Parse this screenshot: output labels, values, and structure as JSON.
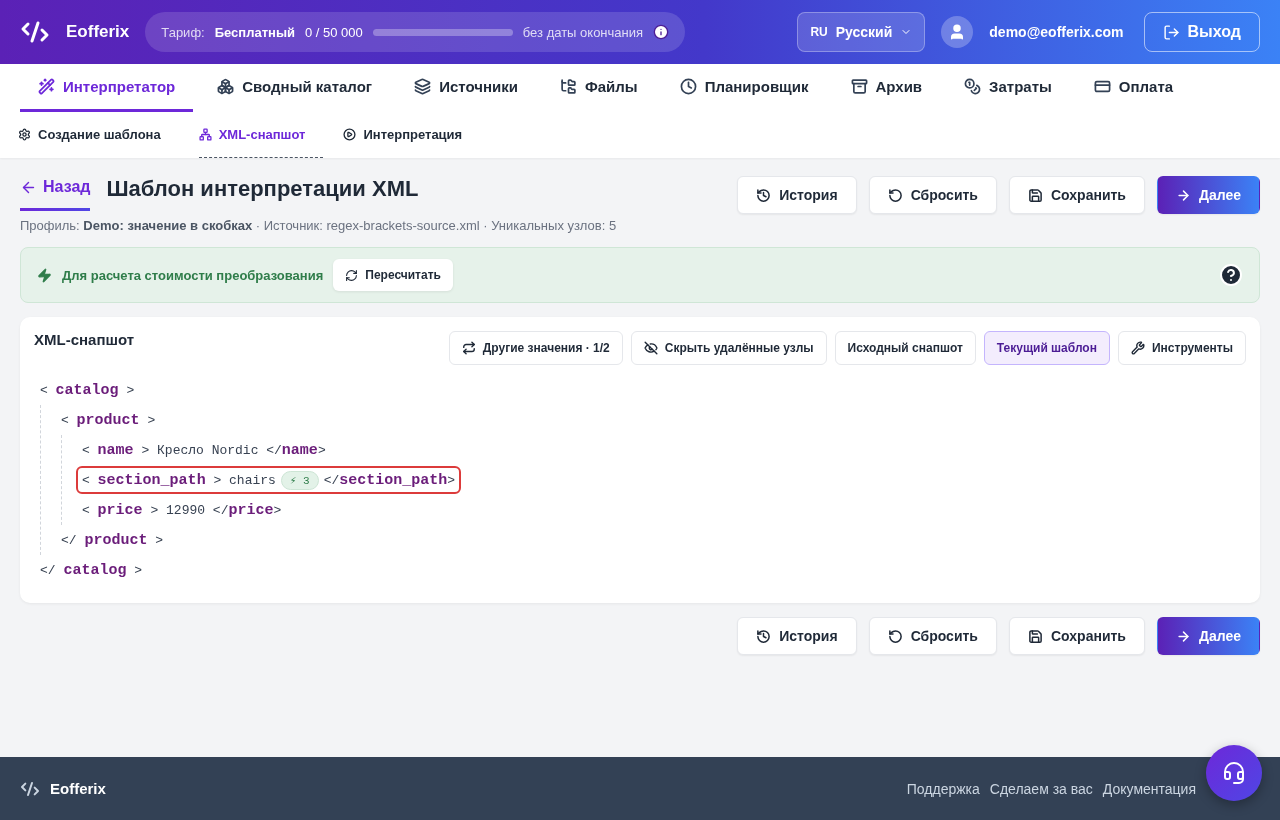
{
  "header": {
    "brand": "Eofferix",
    "plan": {
      "label": "Тариф:",
      "name": "Бесплатный",
      "usage": "0 / 50 000",
      "level": 0,
      "expiry": "без даты окончания"
    },
    "language": {
      "code": "RU",
      "name": "Русский"
    },
    "user": "demo@eofferix.com",
    "logout": "Выход"
  },
  "nav": [
    {
      "label": "Интерпретатор",
      "selected": true
    },
    {
      "label": "Сводный каталог",
      "selected": false
    },
    {
      "label": "Источники",
      "selected": false
    },
    {
      "label": "Файлы",
      "selected": false
    },
    {
      "label": "Планировщик",
      "selected": false
    },
    {
      "label": "Архив",
      "selected": false
    },
    {
      "label": "Затраты",
      "selected": false
    },
    {
      "label": "Оплата",
      "selected": false
    }
  ],
  "subnav": [
    {
      "label": "Создание шаблона",
      "selected": false
    },
    {
      "label": "XML-снапшот",
      "selected": true
    },
    {
      "label": "Интерпретация",
      "selected": false
    }
  ],
  "page": {
    "back": "Назад",
    "title": "Шаблон интерпретации XML",
    "actions": [
      {
        "label": "История",
        "kind": "default"
      },
      {
        "label": "Сбросить",
        "kind": "default"
      },
      {
        "label": "Сохранить",
        "kind": "default"
      },
      {
        "label": "Далее",
        "kind": "primary"
      }
    ],
    "meta": "Профиль: **Demo: значение в скобках** · Источник: regex-brackets-source.xml · Уникальных узлов: 5"
  },
  "notice": {
    "text": "Для расчета стоимости преобразования",
    "button": "Пересчитать"
  },
  "snapshot": {
    "title": "XML-снапшот",
    "toolbar": [
      {
        "label": "Другие значения · 1/2",
        "selected": false
      },
      {
        "label": "Скрыть удалённые узлы",
        "selected": false
      },
      {
        "label": "Исходный снапшот",
        "selected": false
      },
      {
        "label": "Текущий шаблон",
        "selected": true
      },
      {
        "label": "Инструменты",
        "selected": false
      }
    ],
    "tree": {
      "open": "< **catalog** >",
      "close": "</ **catalog** >",
      "children": [
        {
          "open": "< **product** >",
          "close": "</ **product** >",
          "children": [
            {
              "line": "< **name** > Кресло Nordic </**name**>",
              "highlighted": false
            },
            {
              "line": "< **section_path** > chairs",
              "badge": "⚡ 3",
              "end": "</**section_path**>",
              "highlighted": true
            },
            {
              "line": "< **price** > 12990 </**price**>",
              "highlighted": false
            }
          ]
        }
      ]
    }
  },
  "bottom_actions": [
    {
      "label": "История",
      "kind": "default"
    },
    {
      "label": "Сбросить",
      "kind": "default"
    },
    {
      "label": "Сохранить",
      "kind": "default"
    },
    {
      "label": "Далее",
      "kind": "primary"
    }
  ],
  "footer": {
    "brand": "Eofferix",
    "links": [
      "Поддержка",
      "Сделаем за вас",
      "Документация"
    ]
  }
}
